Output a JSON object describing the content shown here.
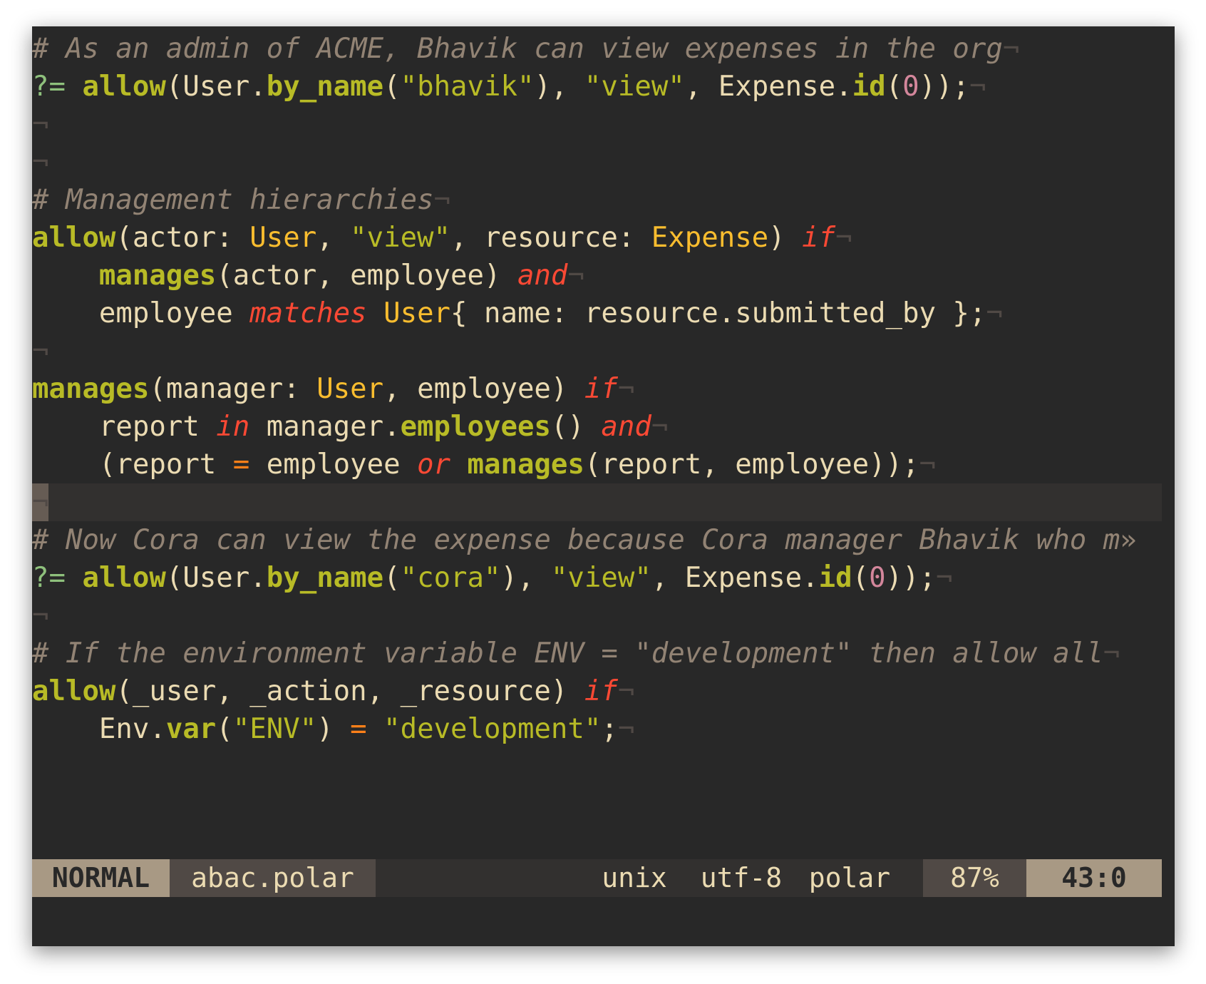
{
  "editor": {
    "lines": [
      [
        {
          "t": "# As an admin of ACME, Bhavik can view expenses in the org",
          "c": "cm"
        },
        {
          "t": "¬",
          "c": "eol"
        }
      ],
      [
        {
          "t": "?=",
          "c": "pr"
        },
        {
          "t": " "
        },
        {
          "t": "allow",
          "c": "fn"
        },
        {
          "t": "(User."
        },
        {
          "t": "by_name",
          "c": "fn"
        },
        {
          "t": "("
        },
        {
          "t": "\"bhavik\"",
          "c": "str"
        },
        {
          "t": "), "
        },
        {
          "t": "\"view\"",
          "c": "str"
        },
        {
          "t": ", Expense."
        },
        {
          "t": "id",
          "c": "fn"
        },
        {
          "t": "("
        },
        {
          "t": "0",
          "c": "num"
        },
        {
          "t": "));"
        },
        {
          "t": "¬",
          "c": "eol"
        }
      ],
      [
        {
          "t": "¬",
          "c": "eol"
        }
      ],
      [
        {
          "t": "¬",
          "c": "eol"
        }
      ],
      [
        {
          "t": "# Management hierarchies",
          "c": "cm"
        },
        {
          "t": "¬",
          "c": "eol"
        }
      ],
      [
        {
          "t": "allow",
          "c": "fn"
        },
        {
          "t": "(actor: "
        },
        {
          "t": "User",
          "c": "ty"
        },
        {
          "t": ", "
        },
        {
          "t": "\"view\"",
          "c": "str"
        },
        {
          "t": ", resource: "
        },
        {
          "t": "Expense",
          "c": "ty"
        },
        {
          "t": ") "
        },
        {
          "t": "if",
          "c": "kw"
        },
        {
          "t": "¬",
          "c": "eol"
        }
      ],
      [
        {
          "t": "    "
        },
        {
          "t": "manages",
          "c": "fn"
        },
        {
          "t": "(actor, employee) "
        },
        {
          "t": "and",
          "c": "kw"
        },
        {
          "t": "¬",
          "c": "eol"
        }
      ],
      [
        {
          "t": "    employee "
        },
        {
          "t": "matches",
          "c": "kw"
        },
        {
          "t": " "
        },
        {
          "t": "User",
          "c": "ty"
        },
        {
          "t": "{ name: resource.submitted_by };"
        },
        {
          "t": "¬",
          "c": "eol"
        }
      ],
      [
        {
          "t": "¬",
          "c": "eol"
        }
      ],
      [
        {
          "t": "manages",
          "c": "fn"
        },
        {
          "t": "(manager: "
        },
        {
          "t": "User",
          "c": "ty"
        },
        {
          "t": ", employee) "
        },
        {
          "t": "if",
          "c": "kw"
        },
        {
          "t": "¬",
          "c": "eol"
        }
      ],
      [
        {
          "t": "    report "
        },
        {
          "t": "in",
          "c": "kw"
        },
        {
          "t": " manager."
        },
        {
          "t": "employees",
          "c": "fn"
        },
        {
          "t": "() "
        },
        {
          "t": "and",
          "c": "kw"
        },
        {
          "t": "¬",
          "c": "eol"
        }
      ],
      [
        {
          "t": "    (report "
        },
        {
          "t": "=",
          "c": "op"
        },
        {
          "t": " employee "
        },
        {
          "t": "or",
          "c": "kw"
        },
        {
          "t": " "
        },
        {
          "t": "manages",
          "c": "fn"
        },
        {
          "t": "(report, employee));"
        },
        {
          "t": "¬",
          "c": "eol"
        }
      ],
      [
        {
          "t": "¬",
          "c": "eol",
          "cursor": true
        }
      ],
      [
        {
          "t": "# Now Cora can view the expense because Cora manager Bhavik who m",
          "c": "cm"
        },
        {
          "t": "»",
          "c": "tr"
        }
      ],
      [
        {
          "t": "?=",
          "c": "pr"
        },
        {
          "t": " "
        },
        {
          "t": "allow",
          "c": "fn"
        },
        {
          "t": "(User."
        },
        {
          "t": "by_name",
          "c": "fn"
        },
        {
          "t": "("
        },
        {
          "t": "\"cora\"",
          "c": "str"
        },
        {
          "t": "), "
        },
        {
          "t": "\"view\"",
          "c": "str"
        },
        {
          "t": ", Expense."
        },
        {
          "t": "id",
          "c": "fn"
        },
        {
          "t": "("
        },
        {
          "t": "0",
          "c": "num"
        },
        {
          "t": "));"
        },
        {
          "t": "¬",
          "c": "eol"
        }
      ],
      [
        {
          "t": "¬",
          "c": "eol"
        }
      ],
      [
        {
          "t": "# If the environment variable ENV = \"development\" then allow all",
          "c": "cm"
        },
        {
          "t": "¬",
          "c": "eol"
        }
      ],
      [
        {
          "t": "allow",
          "c": "fn"
        },
        {
          "t": "(_user, _action, _resource) "
        },
        {
          "t": "if",
          "c": "kw"
        },
        {
          "t": "¬",
          "c": "eol"
        }
      ],
      [
        {
          "t": "    Env."
        },
        {
          "t": "var",
          "c": "fn"
        },
        {
          "t": "("
        },
        {
          "t": "\"ENV\"",
          "c": "str"
        },
        {
          "t": ") "
        },
        {
          "t": "=",
          "c": "op"
        },
        {
          "t": " "
        },
        {
          "t": "\"development\"",
          "c": "str"
        },
        {
          "t": ";"
        },
        {
          "t": "¬",
          "c": "eol"
        }
      ]
    ],
    "cursor_line_index": 12
  },
  "statusline": {
    "mode": "NORMAL",
    "filename": "abac.polar",
    "fileformat": "unix",
    "encoding": "utf-8",
    "filetype": "polar",
    "percent": "87%",
    "position": "43:0"
  },
  "colors": {
    "background": "#282828",
    "foreground": "#ebdbb2",
    "comment": "#928374",
    "function": "#b8bb26",
    "string": "#b8bb26",
    "type": "#fabd2f",
    "keyword": "#fb4934",
    "number": "#d3869b",
    "operator": "#fe8019"
  }
}
